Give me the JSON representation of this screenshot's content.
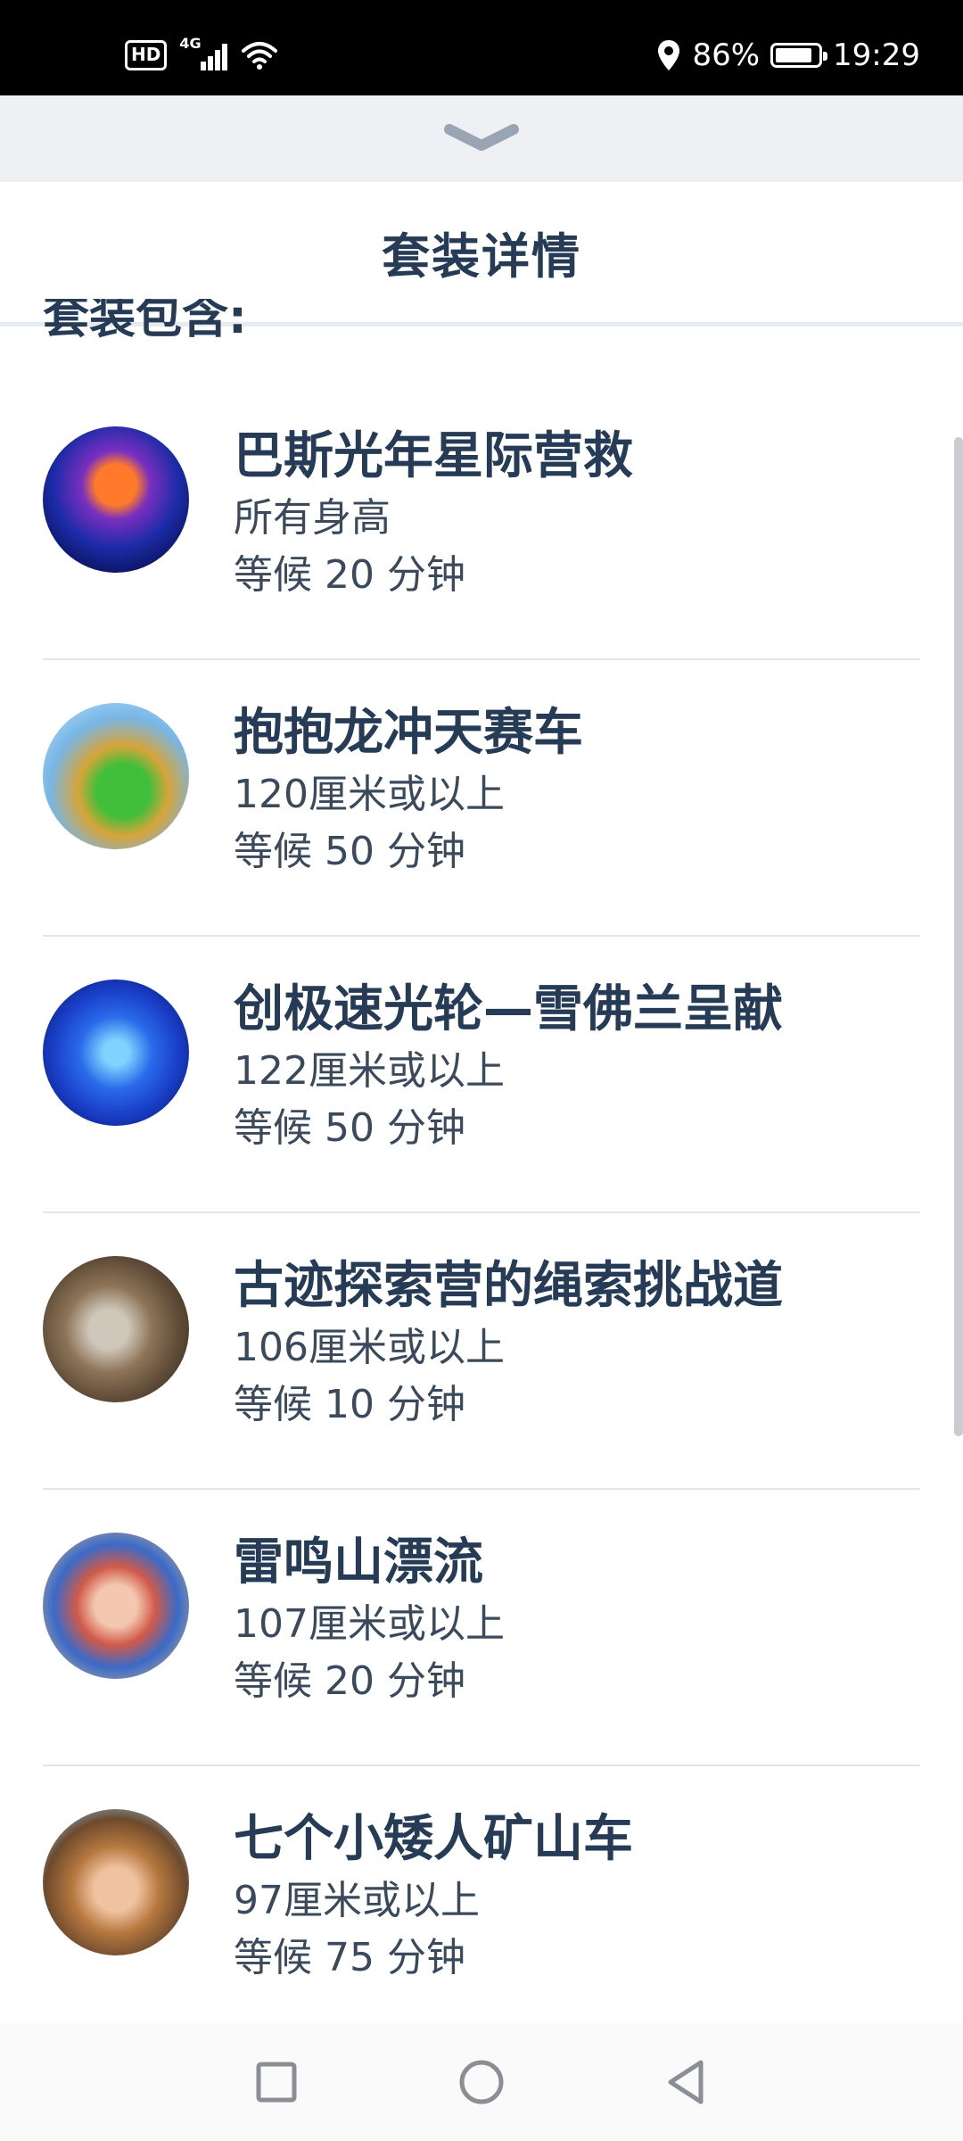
{
  "status_bar": {
    "hd_label": "HD",
    "network_label": "4G",
    "battery_percent": "86%",
    "battery_level": 0.86,
    "time": "19:29"
  },
  "header": {
    "title": "套装详情"
  },
  "section": {
    "partial_heading": "套装包含:"
  },
  "attractions": [
    {
      "name": "巴斯光年星际营救",
      "height": "所有身高",
      "wait": "等候 20 分钟"
    },
    {
      "name": "抱抱龙冲天赛车",
      "height": "120厘米或以上",
      "wait": "等候 50 分钟"
    },
    {
      "name": "创极速光轮—雪佛兰呈献",
      "height": "122厘米或以上",
      "wait": "等候 50 分钟"
    },
    {
      "name": "古迹探索营的绳索挑战道",
      "height": "106厘米或以上",
      "wait": "等候 10 分钟"
    },
    {
      "name": "雷鸣山漂流",
      "height": "107厘米或以上",
      "wait": "等候 20 分钟"
    },
    {
      "name": "七个小矮人矿山车",
      "height": "97厘米或以上",
      "wait": "等候 75 分钟"
    }
  ],
  "icons": {
    "drag_handle": "chevron-down-icon",
    "nav_recent": "square-icon",
    "nav_home": "circle-icon",
    "nav_back": "triangle-back-icon"
  },
  "colors": {
    "title_text": "#253b56",
    "body_text": "#3a4a5c",
    "drag_bar": "#eef0f3",
    "divider": "#e3e6ea"
  }
}
